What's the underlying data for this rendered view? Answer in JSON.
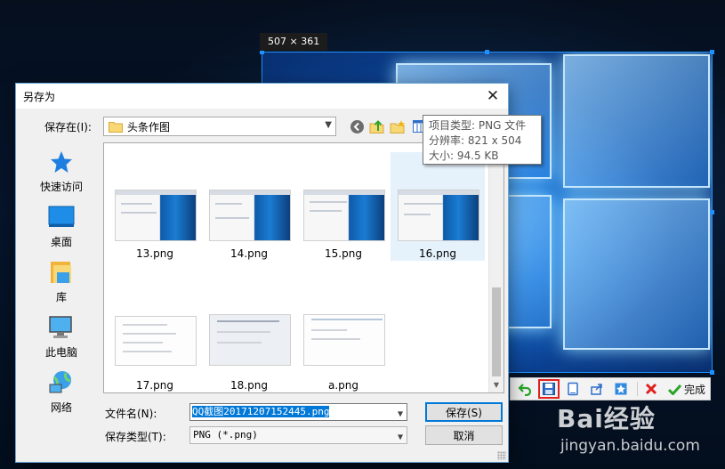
{
  "capture": {
    "size_label": "507 × 361",
    "toolbar": {
      "buttons": [
        "undo-icon",
        "save-icon",
        "copy-icon",
        "share-icon",
        "pin-icon",
        "cancel-icon"
      ],
      "done_label": "完成",
      "colors": {
        "accent": "#1e90ff",
        "active_border": "#e0201e",
        "done_check": "#2aa52a",
        "cancel": "#e0201e"
      }
    }
  },
  "watermark": {
    "logo": "Bai经验",
    "url": "jingyan.baidu.com"
  },
  "dialog": {
    "title": "另存为",
    "close_glyph": "✕",
    "save_in_label": "保存在(I):",
    "folder": "头条作图",
    "nav_icons": [
      "back-icon",
      "up-folder-icon",
      "new-folder-icon",
      "view-menu-icon"
    ],
    "places": [
      "快速访问",
      "桌面",
      "库",
      "此电脑",
      "网络"
    ],
    "files": [
      {
        "name": "13.png",
        "kind": "shot"
      },
      {
        "name": "14.png",
        "kind": "shot"
      },
      {
        "name": "15.png",
        "kind": "shot"
      },
      {
        "name": "16.png",
        "kind": "shot",
        "selected": true
      },
      {
        "name": "17.png",
        "kind": "doc"
      },
      {
        "name": "18.png",
        "kind": "doc"
      },
      {
        "name": "a.png",
        "kind": "doc"
      }
    ],
    "tooltip": {
      "type": "项目类型: PNG 文件",
      "resolution": "分辨率: 821 x 504",
      "size": "大小: 94.5 KB"
    },
    "file_name_label": "文件名(N):",
    "file_name_value": "QQ截图20171207152445.png",
    "file_type_label": "保存类型(T):",
    "file_type_value": "PNG (*.png)",
    "save_button": "保存(S)",
    "cancel_button": "取消"
  }
}
